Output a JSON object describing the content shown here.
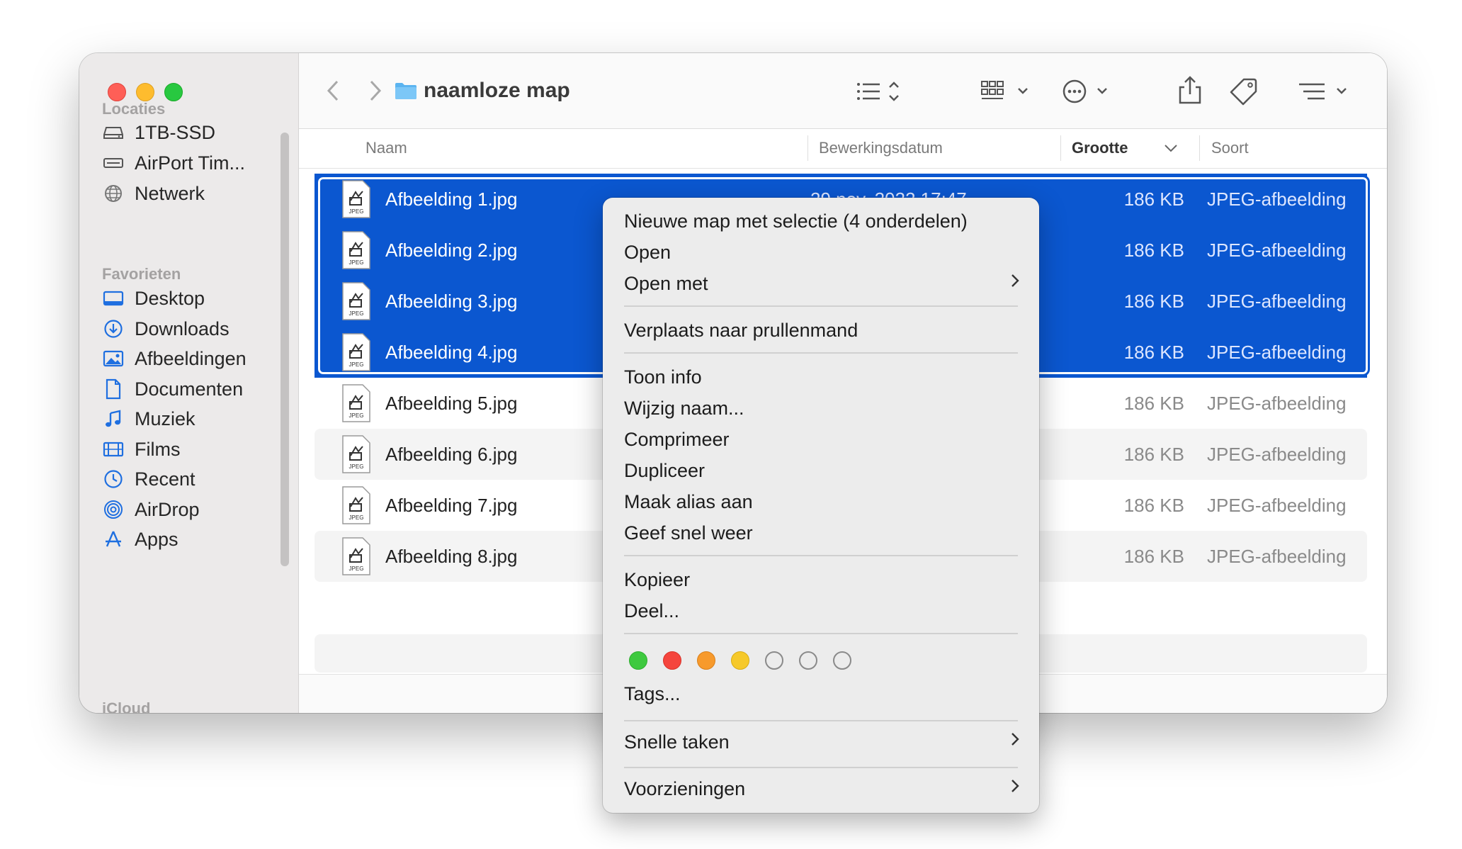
{
  "window": {
    "title": "naamloze map"
  },
  "sidebar": {
    "sections": [
      {
        "heading": "Locaties",
        "items": [
          {
            "label": "1TB-SSD",
            "icon": "drive-icon"
          },
          {
            "label": "AirPort Tim...",
            "icon": "airport-drive-icon"
          },
          {
            "label": "Netwerk",
            "icon": "network-globe-icon"
          }
        ]
      },
      {
        "heading": "Favorieten",
        "items": [
          {
            "label": "Desktop",
            "icon": "desktop-icon"
          },
          {
            "label": "Downloads",
            "icon": "downloads-icon"
          },
          {
            "label": "Afbeeldingen",
            "icon": "pictures-icon"
          },
          {
            "label": "Documenten",
            "icon": "document-icon"
          },
          {
            "label": "Muziek",
            "icon": "music-note-icon"
          },
          {
            "label": "Films",
            "icon": "film-icon"
          },
          {
            "label": "Recent",
            "icon": "clock-icon"
          },
          {
            "label": "AirDrop",
            "icon": "airdrop-icon"
          },
          {
            "label": "Apps",
            "icon": "apps-icon"
          }
        ]
      },
      {
        "heading": "iCloud",
        "items": []
      }
    ]
  },
  "columns": {
    "name": "Naam",
    "date": "Bewerkingsdatum",
    "size": "Grootte",
    "kind": "Soort"
  },
  "files": [
    {
      "name": "Afbeelding 1.jpg",
      "date": "29 nov. 2022 17:47",
      "size": "186 KB",
      "kind": "JPEG-afbeelding",
      "selected": true
    },
    {
      "name": "Afbeelding 2.jpg",
      "size": "186 KB",
      "kind": "JPEG-afbeelding",
      "selected": true
    },
    {
      "name": "Afbeelding 3.jpg",
      "size": "186 KB",
      "kind": "JPEG-afbeelding",
      "selected": true
    },
    {
      "name": "Afbeelding 4.jpg",
      "size": "186 KB",
      "kind": "JPEG-afbeelding",
      "selected": true
    },
    {
      "name": "Afbeelding 5.jpg",
      "size": "186 KB",
      "kind": "JPEG-afbeelding",
      "selected": false
    },
    {
      "name": "Afbeelding 6.jpg",
      "size": "186 KB",
      "kind": "JPEG-afbeelding",
      "selected": false
    },
    {
      "name": "Afbeelding 7.jpg",
      "size": "186 KB",
      "kind": "JPEG-afbeelding",
      "selected": false
    },
    {
      "name": "Afbeelding 8.jpg",
      "size": "186 KB",
      "kind": "JPEG-afbeelding",
      "selected": false
    }
  ],
  "file_badge": "JPEG",
  "context_menu": {
    "items": [
      {
        "label": "Nieuwe map met selectie (4 onderdelen)"
      },
      {
        "label": "Open"
      },
      {
        "label": "Open met",
        "submenu": true
      },
      {
        "label": "Verplaats naar prullenmand"
      },
      {
        "label": "Toon info"
      },
      {
        "label": "Wijzig naam..."
      },
      {
        "label": "Comprimeer"
      },
      {
        "label": "Dupliceer"
      },
      {
        "label": "Maak alias aan"
      },
      {
        "label": "Geef snel weer"
      },
      {
        "label": "Kopieer"
      },
      {
        "label": "Deel..."
      },
      {
        "label": "Tags..."
      },
      {
        "label": "Snelle taken",
        "submenu": true
      },
      {
        "label": "Voorzieningen",
        "submenu": true
      }
    ],
    "tag_colors": [
      "#3ec93f",
      "#f5453d",
      "#f79a2c",
      "#f6c92a",
      "none",
      "none",
      "none"
    ]
  },
  "colors": {
    "selection": "#0b57d0",
    "folder": "#5bb4f0"
  }
}
